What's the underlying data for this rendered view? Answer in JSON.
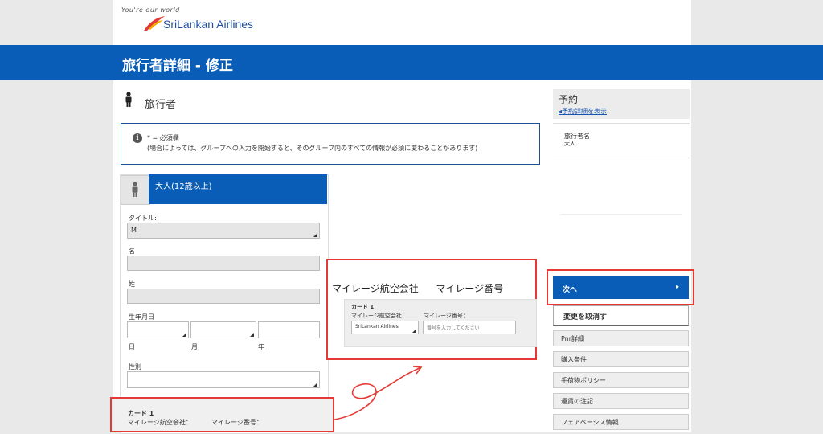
{
  "header": {
    "tagline": "You're our world",
    "logo_text": "SriLankan Airlines",
    "page_title": "旅行者詳細 - 修正"
  },
  "traveler_section": {
    "title": "旅行者"
  },
  "info": {
    "required_note": "* = 必須欄",
    "group_note": "(場合によっては、グループへの入力を開始すると、そのグループ内のすべての情報が必須に変わることがあります)"
  },
  "form": {
    "passenger_type": "大人(12歳以上)",
    "title_label": "タイトル:",
    "title_value": "M",
    "first_name_label": "名",
    "last_name_label": "姓",
    "dob_label": "生年月日",
    "day_label": "日",
    "month_label": "月",
    "year_label": "年",
    "gender_label": "性別",
    "card_title": "カード 1",
    "card_airline_label": "マイレージ航空会社：",
    "card_number_label": "マイレージ番号："
  },
  "callout": {
    "title_airline": "マイレージ航空会社",
    "title_number": "マイレージ番号",
    "card_title": "カード 1",
    "airline_label": "マイレージ航空会社：",
    "number_label": "マイレージ番号：",
    "airline_value": "SriLankan Airlines",
    "number_placeholder": "番号を入力してください"
  },
  "sidebar": {
    "title": "予約",
    "details_link": "予約詳細を表示",
    "traveler_name_label": "旅行者名",
    "traveler_name_value": "大人",
    "next_button": "次へ",
    "cancel_button": "変更を取消す",
    "links": [
      "Pnr詳細",
      "購入条件",
      "手荷物ポリシー",
      "運賃の注記",
      "フェアベーシス情報"
    ]
  },
  "colors": {
    "brand_blue": "#0a5db6",
    "annotation_red": "#e53935"
  }
}
